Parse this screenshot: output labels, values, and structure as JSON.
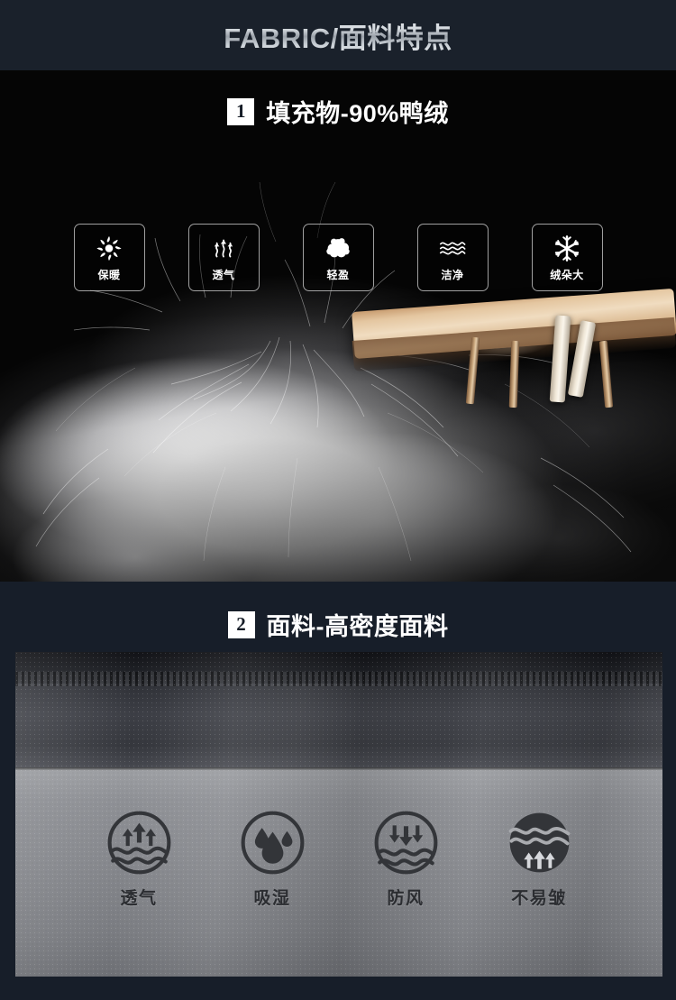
{
  "header": {
    "title_en": "FABRIC",
    "separator": "/",
    "title_cn": "面料特点"
  },
  "section1": {
    "badge": "1",
    "heading": "填充物-90%鸭绒",
    "features": [
      {
        "label": "保暖",
        "icon": "sun-icon"
      },
      {
        "label": "透气",
        "icon": "rising-air-icon"
      },
      {
        "label": "轻盈",
        "icon": "cloud-icon"
      },
      {
        "label": "洁净",
        "icon": "waves-icon"
      },
      {
        "label": "绒朵大",
        "icon": "snowflake-icon"
      }
    ],
    "photo_alt": "白色鸭绒绒朵与竹编容器"
  },
  "section2": {
    "badge": "2",
    "heading": "面料-高密度面料",
    "features": [
      {
        "label": "透气",
        "icon": "breathable-arrows-up-waves-icon"
      },
      {
        "label": "吸湿",
        "icon": "water-drops-icon"
      },
      {
        "label": "防风",
        "icon": "windproof-arrows-down-waves-icon"
      },
      {
        "label": "不易皱",
        "icon": "wrinkle-resistant-filled-waves-icon"
      }
    ],
    "photo_alt": "高密度防绒面料特写"
  },
  "colors": {
    "background_navy": "#1a212b",
    "section2_navy": "#171e29",
    "photo_black": "#050505",
    "badge_bg": "#ffffff",
    "badge_text": "#151c26",
    "heading_text": "#ffffff",
    "title_silver": "#cfd4da",
    "fabric_gray": "#85878c",
    "fabric_label": "#2b2d31"
  }
}
